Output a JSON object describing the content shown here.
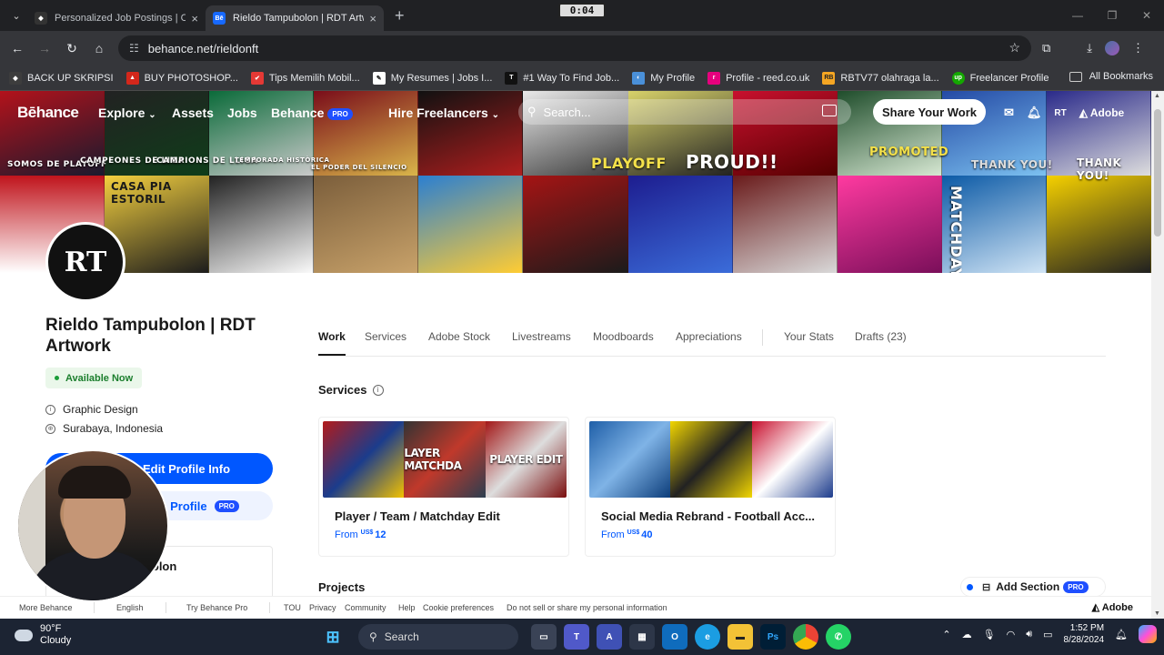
{
  "browser": {
    "tabs": [
      {
        "title": "Personalized Job Postings | Com",
        "active": false
      },
      {
        "title": "Rieldo Tampubolon | RDT Artwo",
        "active": true
      }
    ],
    "recording_time": "0:04",
    "url": "behance.net/rieldonft",
    "bookmarks": [
      {
        "label": "BACK UP SKRIPSI",
        "color": "#3d3d3d"
      },
      {
        "label": "BUY PHOTOSHOP...",
        "color": "#d4271b"
      },
      {
        "label": "Tips Memilih Mobil...",
        "color": "#e53935"
      },
      {
        "label": "My Resumes | Jobs I...",
        "color": "#ffffff"
      },
      {
        "label": "#1 Way To Find Job...",
        "color": "#111111"
      },
      {
        "label": "My Profile",
        "color": "#4a90d9"
      },
      {
        "label": "Profile - reed.co.uk",
        "color": "#e6007e"
      },
      {
        "label": "RBTV77 olahraga la...",
        "color": "#f5a623"
      },
      {
        "label": "Freelancer Profile",
        "color": "#14a800"
      }
    ],
    "all_bookmarks": "All Bookmarks"
  },
  "behance_nav": {
    "logo": "Bēhance",
    "explore": "Explore",
    "assets": "Assets",
    "jobs": "Jobs",
    "behance_pro": "Behance",
    "pro_badge": "PRO",
    "hire": "Hire Freelancers",
    "search_placeholder": "Search...",
    "share": "Share Your Work",
    "avatar_initials": "RT",
    "adobe": "Adobe"
  },
  "cover_labels": [
    "SOMOS DE PLAYOFF",
    "CAMPEONES DE LIGA",
    "CAMPIONS DE LLIGA",
    "TEMPORADA HISTÒRICA",
    "EL PODER DEL SILENCIO",
    "PLAYOFF",
    "PROUD!!",
    "PROMOTED",
    "THANK YOU!",
    "THANK YOU!",
    "CASA PIA ESTORIL",
    "MATCHDAY"
  ],
  "profile": {
    "avatar_initials": "RT",
    "name": "Rieldo Tampubolon | RDT Artwork",
    "availability": "Available Now",
    "occupation": "Graphic Design",
    "location": "Surabaya, Indonesia",
    "edit_button": "Edit Profile Info",
    "profile_button": "Profile",
    "pro_badge": "PRO",
    "card_name": "ubolon"
  },
  "profile_tabs": [
    "Work",
    "Services",
    "Adobe Stock",
    "Livestreams",
    "Moodboards",
    "Appreciations",
    "Your Stats",
    "Drafts (23)"
  ],
  "services": {
    "title": "Services",
    "cards": [
      {
        "title": "Player / Team / Matchday Edit",
        "from": "From",
        "currency": "US$",
        "amount": "12",
        "thumb_labels": [
          "",
          "LAYER MATCHDA",
          "PLAYER EDIT"
        ]
      },
      {
        "title": "Social Media Rebrand - Football Acc...",
        "from": "From",
        "currency": "US$",
        "amount": "40",
        "thumb_labels": [
          "",
          "",
          ""
        ]
      }
    ]
  },
  "projects": {
    "title": "Projects",
    "add_section": "Add Section",
    "pro_badge": "PRO"
  },
  "footer": {
    "links": [
      "More Behance",
      "English",
      "Try Behance Pro",
      "TOU",
      "Privacy",
      "Community",
      "Help",
      "Cookie preferences",
      "Do not sell or share my personal information"
    ],
    "adobe": "Adobe"
  },
  "taskbar": {
    "temperature": "90°F",
    "condition": "Cloudy",
    "search": "Search",
    "time": "1:52 PM",
    "date": "8/28/2024"
  }
}
